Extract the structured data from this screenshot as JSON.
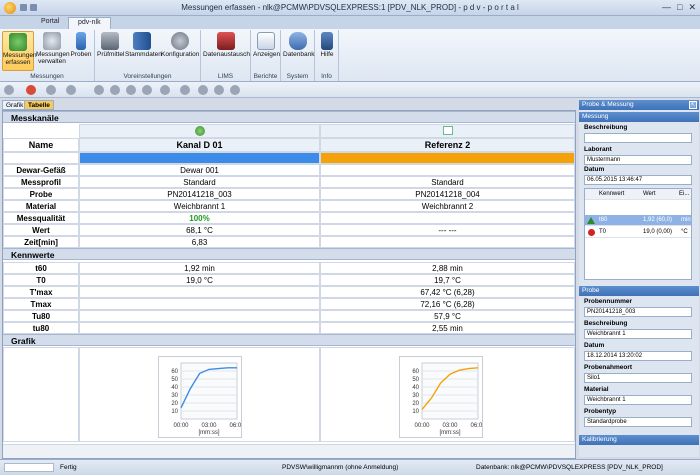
{
  "window": {
    "title": "Messungen erfassen - nlk@PCMW\\PDVSQLEXPRESS:1 [PDV_NLK_PROD] - p d v - p o r t a l",
    "controls": [
      "—",
      "□",
      "✕"
    ]
  },
  "ribbon_tabs": [
    "Portal",
    "pdv-nlk"
  ],
  "ribbon": {
    "groups": [
      {
        "label": "Messungen",
        "buttons": [
          "Messungen erfassen",
          "Messungen verwalten",
          "Proben"
        ]
      },
      {
        "label": "Voreinstellungen",
        "buttons": [
          "Prüfmittel",
          "Stammdaten",
          "Konfiguration"
        ]
      },
      {
        "label": "LIMS",
        "buttons": [
          "Datenaustausch"
        ]
      },
      {
        "label": "Berichte",
        "buttons": [
          "Anzeigen"
        ]
      },
      {
        "label": "System",
        "buttons": [
          "Datenbank"
        ]
      },
      {
        "label": "Info",
        "buttons": [
          "Hilfe"
        ]
      }
    ]
  },
  "content_tabs": [
    "Grafik",
    "Tabelle"
  ],
  "messkanaele": {
    "section": "Messkanäle",
    "name_label": "Name",
    "channels": [
      "Kanal D 01",
      "Referenz 2"
    ],
    "channel_colors": [
      "#3d8be8",
      "#f5a20a"
    ],
    "rows": [
      {
        "label": "Dewar-Gefäß",
        "v1": "Dewar 001",
        "v2": ""
      },
      {
        "label": "Messprofil",
        "v1": "Standard",
        "v2": "Standard"
      },
      {
        "label": "Probe",
        "v1": "PN20141218_003",
        "v2": "PN20141218_004"
      },
      {
        "label": "Material",
        "v1": "Weichbrannt 1",
        "v2": "Weichbrannt 2"
      },
      {
        "label": "Messqualität",
        "v1": "100%",
        "v2": ""
      },
      {
        "label": "Wert",
        "v1": "68,1 °C",
        "v2": "---  ---"
      },
      {
        "label": "Zeit[min]",
        "v1": "6,83",
        "v2": ""
      }
    ]
  },
  "kennwerte": {
    "section": "Kennwerte",
    "rows": [
      {
        "label": "t60",
        "v1": "1,92 min",
        "v2": "2,88 min"
      },
      {
        "label": "T0",
        "v1": "19,0 °C",
        "v2": "19,7 °C"
      },
      {
        "label": "T'max",
        "v1": "",
        "v2": "67,42 °C (6,28)"
      },
      {
        "label": "Tmax",
        "v1": "",
        "v2": "72,16 °C (6,28)"
      },
      {
        "label": "Tu80",
        "v1": "",
        "v2": "57,9 °C"
      },
      {
        "label": "tu80",
        "v1": "",
        "v2": "2,55 min"
      }
    ]
  },
  "grafik": {
    "section": "Grafik",
    "y_ticks": [
      "60",
      "50",
      "40",
      "30",
      "20",
      "10"
    ],
    "x_ticks": [
      "00:00",
      "03:00",
      "06:00"
    ],
    "x_label": "[mm:ss]"
  },
  "chart_data": [
    {
      "type": "line",
      "series": [
        {
          "values": [
            [
              0,
              14
            ],
            [
              1,
              38
            ],
            [
              2,
              57
            ],
            [
              3,
              62
            ],
            [
              4,
              63
            ],
            [
              5,
              64
            ],
            [
              6,
              64
            ]
          ]
        }
      ],
      "x_ticks": [
        "00:00",
        "03:00",
        "06:00"
      ],
      "xlabel": "[mm:ss]",
      "ylim": [
        0,
        70
      ],
      "color": "#3d8be8"
    },
    {
      "type": "line",
      "series": [
        {
          "values": [
            [
              0,
              12
            ],
            [
              1,
              26
            ],
            [
              2,
              45
            ],
            [
              3,
              56
            ],
            [
              4,
              61
            ],
            [
              5,
              63
            ],
            [
              6,
              64
            ]
          ]
        }
      ],
      "x_ticks": [
        "00:00",
        "03:00",
        "06:00"
      ],
      "xlabel": "[mm:ss]",
      "ylim": [
        0,
        70
      ],
      "color": "#f5a20a"
    }
  ],
  "side": {
    "header": "Probe & Messung",
    "messung": {
      "title": "Messung",
      "beschreibung_label": "Beschreibung",
      "beschreibung": "",
      "laborant_label": "Laborant",
      "laborant": "Mustermann",
      "datum_label": "Datum",
      "datum": "06.05.2015 13:46:47",
      "kennwert_cols": [
        "Kennwert",
        "Wert",
        "Ei..."
      ],
      "kennwerte": [
        {
          "name": "t60",
          "wert": "1,92 (60,0)",
          "unit": "min"
        },
        {
          "name": "T0",
          "wert": "19,0 (0,00)",
          "unit": "°C"
        }
      ]
    },
    "probe": {
      "title": "Probe",
      "fields": [
        {
          "label": "Probennummer",
          "value": "PN20141218_003"
        },
        {
          "label": "Beschreibung",
          "value": "Weichbrannt 1"
        },
        {
          "label": "Datum",
          "value": "18.12.2014 13:20:02"
        },
        {
          "label": "Probenahmeort",
          "value": "Silo1"
        },
        {
          "label": "Material",
          "value": "Weichbrannt 1"
        },
        {
          "label": "Probentyp",
          "value": "Standardprobe"
        }
      ]
    },
    "kalibrierung": "Kalibrierung"
  },
  "status": {
    "left": "Fertig",
    "mid": "PDVSW\\willigmannm (ohne Anmeldung)",
    "right": "Datenbank: nlk@PCMW\\PDVSQLEXPRESS [PDV_NLK_PROD]"
  }
}
